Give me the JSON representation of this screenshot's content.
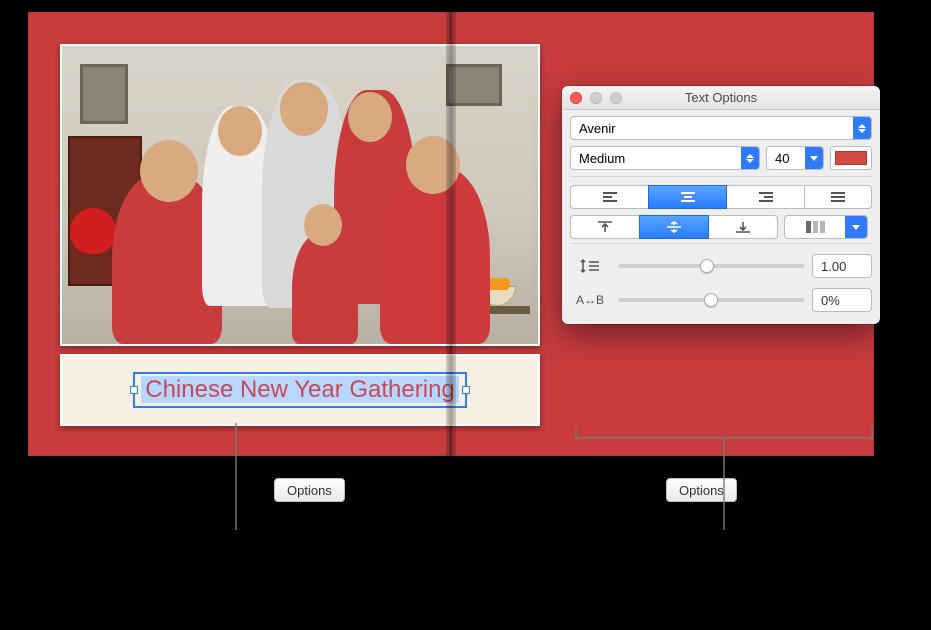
{
  "book": {
    "caption": "Chinese New Year Gathering"
  },
  "options_buttons": {
    "left": "Options",
    "right": "Options"
  },
  "panel": {
    "title": "Text Options",
    "font": "Avenir",
    "weight": "Medium",
    "size": "40",
    "color_swatch": "#d24942",
    "halign_selected": "center",
    "valign_selected": "middle",
    "line_spacing": "1.00",
    "char_spacing": "0%",
    "char_spacing_label": "A↔B",
    "slider_line_pos_pct": 48,
    "slider_char_pos_pct": 50
  }
}
